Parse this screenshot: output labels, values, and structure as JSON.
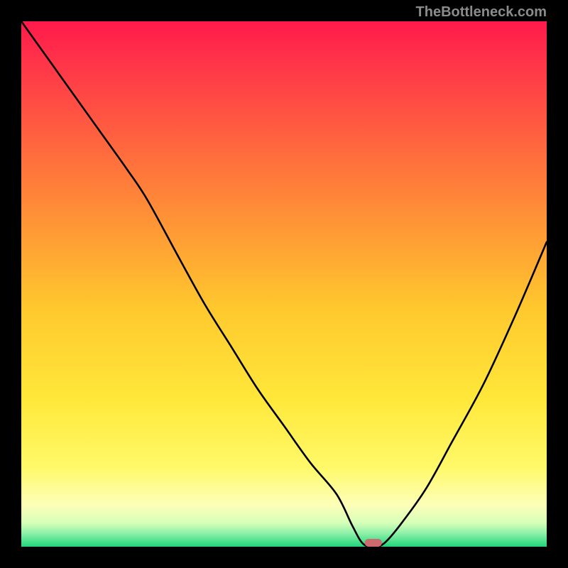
{
  "watermark": "TheBottleneck.com",
  "chart_data": {
    "type": "line",
    "title": "",
    "xlabel": "",
    "ylabel": "",
    "xlim": [
      0,
      100
    ],
    "ylim": [
      0,
      100
    ],
    "grid": false,
    "legend": false,
    "annotations": [],
    "marker": {
      "x": 67,
      "y": 0,
      "color": "#cd6a6d"
    },
    "series": [
      {
        "name": "bottleneck-curve",
        "color": "#000000",
        "x": [
          0,
          5,
          10,
          15,
          20,
          24,
          30,
          35,
          40,
          45,
          50,
          55,
          60,
          63,
          65,
          67,
          69,
          72,
          77,
          82,
          88,
          94,
          100
        ],
        "y": [
          100,
          93,
          86,
          79,
          72,
          66,
          55,
          46,
          38,
          30,
          23,
          16,
          10,
          4,
          0.6,
          0,
          0.6,
          4,
          11,
          20,
          31,
          44,
          58
        ]
      }
    ],
    "background_gradient": {
      "stops": [
        {
          "offset": 0.0,
          "color": "#ff1a4b"
        },
        {
          "offset": 0.1,
          "color": "#ff3b48"
        },
        {
          "offset": 0.25,
          "color": "#ff6b3d"
        },
        {
          "offset": 0.4,
          "color": "#ff9a35"
        },
        {
          "offset": 0.55,
          "color": "#ffc92e"
        },
        {
          "offset": 0.72,
          "color": "#ffe83a"
        },
        {
          "offset": 0.85,
          "color": "#fff96a"
        },
        {
          "offset": 0.92,
          "color": "#fdffb8"
        },
        {
          "offset": 0.955,
          "color": "#d6ffb8"
        },
        {
          "offset": 0.975,
          "color": "#8cf0a8"
        },
        {
          "offset": 1.0,
          "color": "#1fd67a"
        }
      ]
    }
  }
}
